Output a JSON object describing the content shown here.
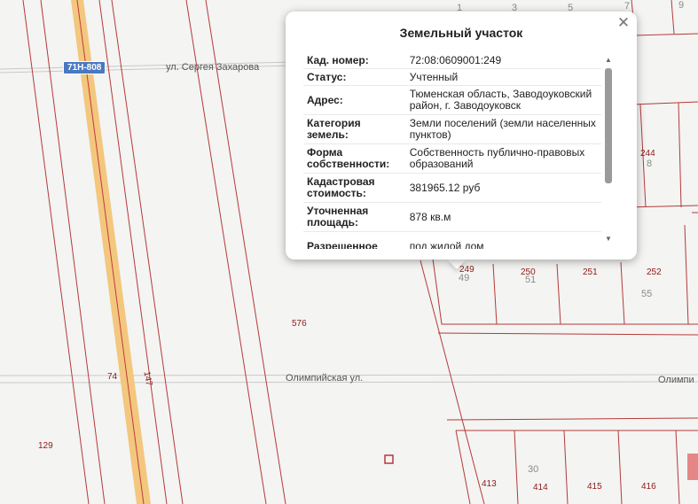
{
  "map": {
    "streets": [
      "ул. Сергея Захарова",
      "Олимпийская ул.",
      "Олимпи"
    ],
    "road_shields": [
      "71Н-808"
    ],
    "parcel_numbers": [
      "576",
      "74",
      "147",
      "129",
      "244",
      "249",
      "250",
      "251",
      "252",
      "413",
      "414",
      "415",
      "416"
    ],
    "house_numbers": [
      "1",
      "3",
      "5",
      "7",
      "9",
      "8",
      "49",
      "51",
      "55",
      "30"
    ],
    "colors": {
      "background": "#f4f4f2",
      "parcel_line": "#b33a3a",
      "road_fill": "#f3c77e",
      "street_line": "#c9c9c9"
    }
  },
  "popup": {
    "title": "Земельный участок",
    "close_icon": "close-icon",
    "rows": [
      {
        "label": "Кад. номер:",
        "value": "72:08:0609001:249"
      },
      {
        "label": "Статус:",
        "value": "Учтенный"
      },
      {
        "label": "Адрес:",
        "value": "Тюменская область, Заводоуковский район, г. Заводоуковск"
      },
      {
        "label": "Категория земель:",
        "value": "Земли поселений (земли населенных пунктов)"
      },
      {
        "label": "Форма собственности:",
        "value": "Собственность публично-правовых образований"
      },
      {
        "label": "Кадастровая стоимость:",
        "value": "381965.12 руб"
      },
      {
        "label": "Уточненная площадь:",
        "value": "878 кв.м"
      },
      {
        "label": "Разрешенное",
        "value": "под жилой дом"
      }
    ]
  }
}
